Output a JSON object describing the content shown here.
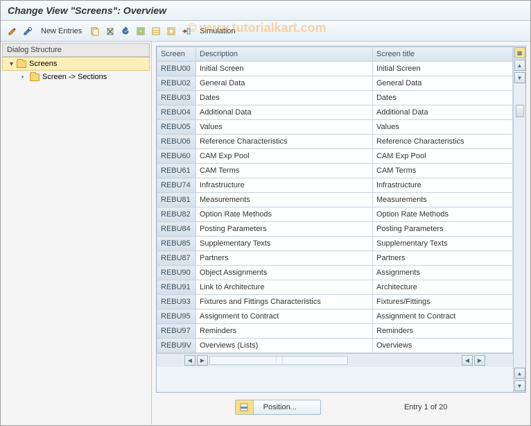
{
  "title": "Change View \"Screens\": Overview",
  "watermark": "© www.tutorialkart.com",
  "toolbar": {
    "new_entries": "New Entries",
    "simulation": "Simulation"
  },
  "tree": {
    "header": "Dialog Structure",
    "root": "Screens",
    "child": "Screen -> Sections"
  },
  "grid": {
    "headers": {
      "screen": "Screen",
      "description": "Description",
      "title": "Screen title"
    },
    "rows": [
      {
        "s": "REBU00",
        "d": "Initial Screen",
        "t": "Initial Screen"
      },
      {
        "s": "REBU02",
        "d": "General Data",
        "t": "General Data"
      },
      {
        "s": "REBU03",
        "d": "Dates",
        "t": "Dates"
      },
      {
        "s": "REBU04",
        "d": "Additional Data",
        "t": "Additional Data"
      },
      {
        "s": "REBU05",
        "d": "Values",
        "t": "Values"
      },
      {
        "s": "REBU06",
        "d": "Reference Characteristics",
        "t": "Reference Characteristics"
      },
      {
        "s": "REBU60",
        "d": "CAM Exp Pool",
        "t": "CAM Exp Pool"
      },
      {
        "s": "REBU61",
        "d": "CAM Terms",
        "t": "CAM Terms"
      },
      {
        "s": "REBU74",
        "d": "Infrastructure",
        "t": "Infrastructure"
      },
      {
        "s": "REBU81",
        "d": "Measurements",
        "t": "Measurements"
      },
      {
        "s": "REBU82",
        "d": "Option Rate Methods",
        "t": "Option Rate Methods"
      },
      {
        "s": "REBU84",
        "d": "Posting Parameters",
        "t": "Posting Parameters"
      },
      {
        "s": "REBU85",
        "d": "Supplementary Texts",
        "t": "Supplementary Texts"
      },
      {
        "s": "REBU87",
        "d": "Partners",
        "t": "Partners"
      },
      {
        "s": "REBU90",
        "d": "Object Assignments",
        "t": "Assignments"
      },
      {
        "s": "REBU91",
        "d": "Link to Architecture",
        "t": "Architecture"
      },
      {
        "s": "REBU93",
        "d": "Fixtures and Fittings Characteristics",
        "t": "Fixtures/Fittings"
      },
      {
        "s": "REBU95",
        "d": "Assignment to Contract",
        "t": "Assignment to Contract"
      },
      {
        "s": "REBU97",
        "d": "Reminders",
        "t": "Reminders"
      },
      {
        "s": "REBU9V",
        "d": "Overviews (Lists)",
        "t": "Overviews"
      }
    ]
  },
  "footer": {
    "position": "Position...",
    "entry_text": "Entry 1 of 20"
  }
}
